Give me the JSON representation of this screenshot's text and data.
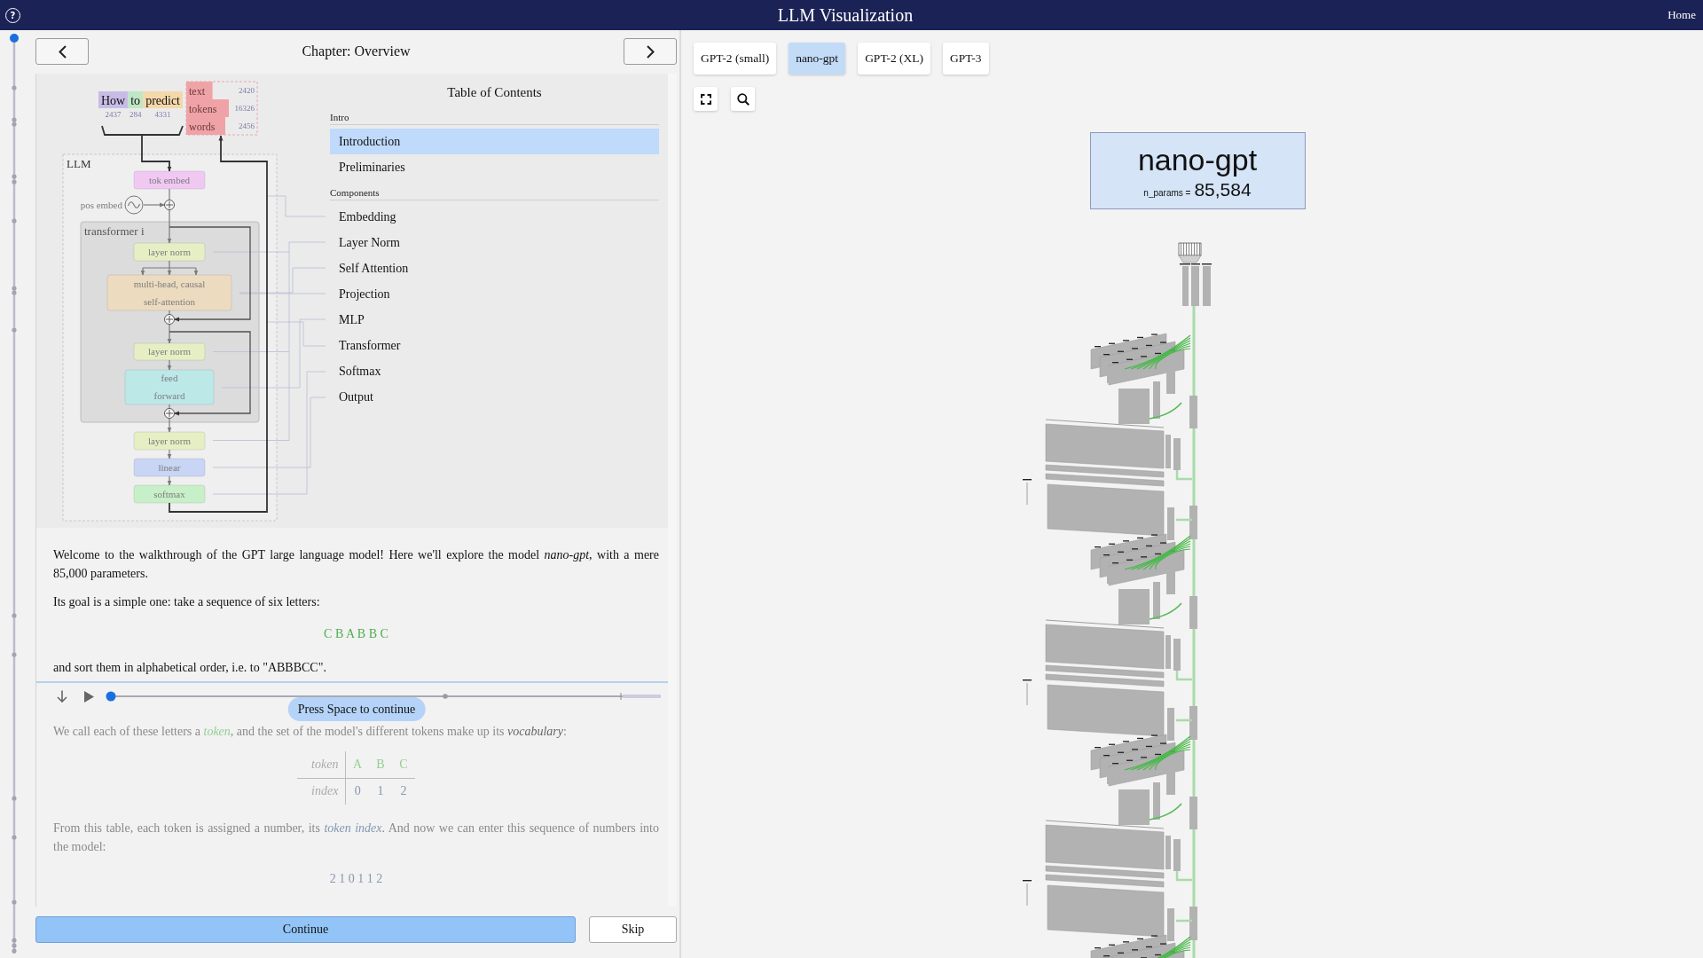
{
  "header": {
    "help_button": "?",
    "title": "LLM Visualization",
    "home_link": "Home"
  },
  "chapter_progress": {
    "level": 0
  },
  "chapter_nav": {
    "title": "Chapter: Overview"
  },
  "diagram": {
    "input_tokens": [
      {
        "text": "How",
        "number": "2437",
        "color": "#c8bce6"
      },
      {
        "text": "to",
        "number": "284",
        "color": "#bfe6c6"
      },
      {
        "text": "predict",
        "number": "4331",
        "color": "#f5d8aa"
      }
    ],
    "output_tokens": [
      {
        "text": "text",
        "number": "2420",
        "level": 0.37
      },
      {
        "text": "tokens",
        "number": "16326",
        "level": 0.6
      },
      {
        "text": "words",
        "number": "2456",
        "level": 0.55
      }
    ],
    "frame_label": "LLM",
    "pos_embed_label": "pos embed",
    "transformer_label": "transformer i",
    "nodes": [
      {
        "lines": [
          "tok embed"
        ],
        "color": "#f0c8f2"
      },
      {
        "lines": [
          "layer norm"
        ],
        "color": "#e6eec4"
      },
      {
        "lines": [
          "multi-head, causal",
          "self-attention"
        ],
        "color": "#ecdbbf"
      },
      {
        "lines": [
          "layer norm"
        ],
        "color": "#e6eec4"
      },
      {
        "lines": [
          "feed",
          "forward"
        ],
        "color": "#bce8e8"
      },
      {
        "lines": [
          "layer norm"
        ],
        "color": "#e6eec4"
      },
      {
        "lines": [
          "linear"
        ],
        "color": "#c9d5f5"
      },
      {
        "lines": [
          "softmax"
        ],
        "color": "#c8f0c8"
      }
    ]
  },
  "toc": {
    "title": "Table of Contents",
    "groups": [
      {
        "heading": "Intro",
        "items": [
          {
            "label": "Introduction",
            "selected": true
          },
          {
            "label": "Preliminaries",
            "selected": false
          }
        ]
      },
      {
        "heading": "Components",
        "items": [
          {
            "label": "Embedding",
            "selected": false
          },
          {
            "label": "Layer Norm",
            "selected": false
          },
          {
            "label": "Self Attention",
            "selected": false
          },
          {
            "label": "Projection",
            "selected": false
          },
          {
            "label": "MLP",
            "selected": false
          },
          {
            "label": "Transformer",
            "selected": false
          },
          {
            "label": "Softmax",
            "selected": false
          },
          {
            "label": "Output",
            "selected": false
          }
        ]
      }
    ]
  },
  "sections": [
    {
      "dimmed": false,
      "blocks": [
        {
          "kind": "paragraph",
          "runs": [
            {
              "kind": "text",
              "text": "Welcome to the walkthrough of the GPT large language model! Here we'll explore the model *nano-gpt*, with a mere 85,000 parameters."
            }
          ]
        },
        {
          "kind": "paragraph",
          "runs": [
            {
              "kind": "text",
              "text": "Its goal is a simple one: take a sequence of six letters:"
            }
          ]
        },
        {
          "kind": "token_sequence",
          "text": "C B A B B C"
        },
        {
          "kind": "paragraph",
          "runs": [
            {
              "kind": "text",
              "text": "and sort them in alphabetical order, i.e. to \"ABBBCC\"."
            }
          ]
        }
      ]
    },
    {
      "dimmed": true,
      "player": {
        "level": 0,
        "hint": "Press Space to continue"
      },
      "blocks": [
        {
          "kind": "paragraph",
          "runs": [
            {
              "kind": "text",
              "text": "We call each of these letters a "
            },
            {
              "kind": "token_term",
              "text": "token"
            },
            {
              "kind": "text",
              "text": ", and the set of the model's different tokens make up its *vocabulary*:"
            }
          ]
        },
        {
          "kind": "table",
          "rows": [
            {
              "kind": "token",
              "header": "token",
              "cells": [
                "A",
                "B",
                "C"
              ]
            },
            {
              "kind": "index",
              "header": "index",
              "cells": [
                "0",
                "1",
                "2"
              ]
            }
          ]
        },
        {
          "kind": "paragraph",
          "runs": [
            {
              "kind": "text",
              "text": "From this table, each token is assigned a number, its "
            },
            {
              "kind": "index_term",
              "text": "token index"
            },
            {
              "kind": "text",
              "text": ". And now we can enter this sequence of numbers into the model:"
            }
          ]
        },
        {
          "kind": "index_sequence",
          "text": "2 1 0 1 1 2"
        }
      ]
    }
  ],
  "actions": [
    {
      "label": "Continue",
      "kind": "primary"
    },
    {
      "label": "Skip",
      "kind": "secondary"
    }
  ],
  "model_tabs": [
    {
      "label": "GPT-2 (small)",
      "selected": false
    },
    {
      "label": "nano-gpt",
      "selected": true
    },
    {
      "label": "GPT-2 (XL)",
      "selected": false
    },
    {
      "label": "GPT-3",
      "selected": false
    }
  ],
  "model_card": {
    "name": "nano-gpt",
    "param_label": "n_params =",
    "param_count": "85,584"
  }
}
